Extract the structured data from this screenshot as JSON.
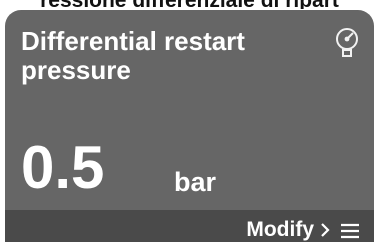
{
  "header": {
    "title": "ressione differenziale di ripart"
  },
  "card": {
    "title": "Differential restart pressure",
    "value": "0.5",
    "unit": "bar",
    "icon": "pressure-gauge-icon",
    "background": "#666666"
  },
  "footer": {
    "modify_label": "Modify",
    "chevron_icon": "chevron-right-icon",
    "menu_icon": "menu-icon",
    "background": "#4a4a4a"
  }
}
